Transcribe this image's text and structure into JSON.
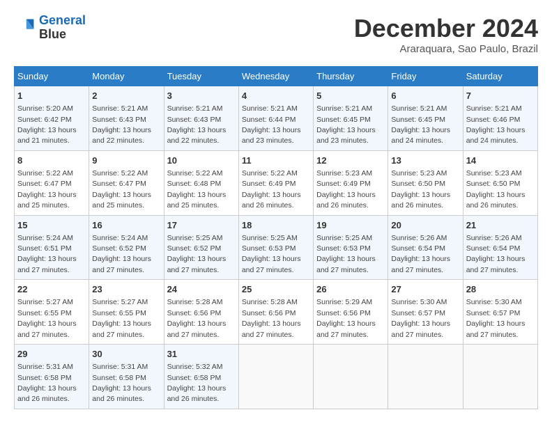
{
  "header": {
    "logo_line1": "General",
    "logo_line2": "Blue",
    "month": "December 2024",
    "location": "Araraquara, Sao Paulo, Brazil"
  },
  "weekdays": [
    "Sunday",
    "Monday",
    "Tuesday",
    "Wednesday",
    "Thursday",
    "Friday",
    "Saturday"
  ],
  "weeks": [
    [
      {
        "day": "1",
        "sunrise": "5:20 AM",
        "sunset": "6:42 PM",
        "daylight": "13 hours and 21 minutes."
      },
      {
        "day": "2",
        "sunrise": "5:21 AM",
        "sunset": "6:43 PM",
        "daylight": "13 hours and 22 minutes."
      },
      {
        "day": "3",
        "sunrise": "5:21 AM",
        "sunset": "6:43 PM",
        "daylight": "13 hours and 22 minutes."
      },
      {
        "day": "4",
        "sunrise": "5:21 AM",
        "sunset": "6:44 PM",
        "daylight": "13 hours and 23 minutes."
      },
      {
        "day": "5",
        "sunrise": "5:21 AM",
        "sunset": "6:45 PM",
        "daylight": "13 hours and 23 minutes."
      },
      {
        "day": "6",
        "sunrise": "5:21 AM",
        "sunset": "6:45 PM",
        "daylight": "13 hours and 24 minutes."
      },
      {
        "day": "7",
        "sunrise": "5:21 AM",
        "sunset": "6:46 PM",
        "daylight": "13 hours and 24 minutes."
      }
    ],
    [
      {
        "day": "8",
        "sunrise": "5:22 AM",
        "sunset": "6:47 PM",
        "daylight": "13 hours and 25 minutes."
      },
      {
        "day": "9",
        "sunrise": "5:22 AM",
        "sunset": "6:47 PM",
        "daylight": "13 hours and 25 minutes."
      },
      {
        "day": "10",
        "sunrise": "5:22 AM",
        "sunset": "6:48 PM",
        "daylight": "13 hours and 25 minutes."
      },
      {
        "day": "11",
        "sunrise": "5:22 AM",
        "sunset": "6:49 PM",
        "daylight": "13 hours and 26 minutes."
      },
      {
        "day": "12",
        "sunrise": "5:23 AM",
        "sunset": "6:49 PM",
        "daylight": "13 hours and 26 minutes."
      },
      {
        "day": "13",
        "sunrise": "5:23 AM",
        "sunset": "6:50 PM",
        "daylight": "13 hours and 26 minutes."
      },
      {
        "day": "14",
        "sunrise": "5:23 AM",
        "sunset": "6:50 PM",
        "daylight": "13 hours and 26 minutes."
      }
    ],
    [
      {
        "day": "15",
        "sunrise": "5:24 AM",
        "sunset": "6:51 PM",
        "daylight": "13 hours and 27 minutes."
      },
      {
        "day": "16",
        "sunrise": "5:24 AM",
        "sunset": "6:52 PM",
        "daylight": "13 hours and 27 minutes."
      },
      {
        "day": "17",
        "sunrise": "5:25 AM",
        "sunset": "6:52 PM",
        "daylight": "13 hours and 27 minutes."
      },
      {
        "day": "18",
        "sunrise": "5:25 AM",
        "sunset": "6:53 PM",
        "daylight": "13 hours and 27 minutes."
      },
      {
        "day": "19",
        "sunrise": "5:25 AM",
        "sunset": "6:53 PM",
        "daylight": "13 hours and 27 minutes."
      },
      {
        "day": "20",
        "sunrise": "5:26 AM",
        "sunset": "6:54 PM",
        "daylight": "13 hours and 27 minutes."
      },
      {
        "day": "21",
        "sunrise": "5:26 AM",
        "sunset": "6:54 PM",
        "daylight": "13 hours and 27 minutes."
      }
    ],
    [
      {
        "day": "22",
        "sunrise": "5:27 AM",
        "sunset": "6:55 PM",
        "daylight": "13 hours and 27 minutes."
      },
      {
        "day": "23",
        "sunrise": "5:27 AM",
        "sunset": "6:55 PM",
        "daylight": "13 hours and 27 minutes."
      },
      {
        "day": "24",
        "sunrise": "5:28 AM",
        "sunset": "6:56 PM",
        "daylight": "13 hours and 27 minutes."
      },
      {
        "day": "25",
        "sunrise": "5:28 AM",
        "sunset": "6:56 PM",
        "daylight": "13 hours and 27 minutes."
      },
      {
        "day": "26",
        "sunrise": "5:29 AM",
        "sunset": "6:56 PM",
        "daylight": "13 hours and 27 minutes."
      },
      {
        "day": "27",
        "sunrise": "5:30 AM",
        "sunset": "6:57 PM",
        "daylight": "13 hours and 27 minutes."
      },
      {
        "day": "28",
        "sunrise": "5:30 AM",
        "sunset": "6:57 PM",
        "daylight": "13 hours and 27 minutes."
      }
    ],
    [
      {
        "day": "29",
        "sunrise": "5:31 AM",
        "sunset": "6:58 PM",
        "daylight": "13 hours and 26 minutes."
      },
      {
        "day": "30",
        "sunrise": "5:31 AM",
        "sunset": "6:58 PM",
        "daylight": "13 hours and 26 minutes."
      },
      {
        "day": "31",
        "sunrise": "5:32 AM",
        "sunset": "6:58 PM",
        "daylight": "13 hours and 26 minutes."
      },
      null,
      null,
      null,
      null
    ]
  ]
}
